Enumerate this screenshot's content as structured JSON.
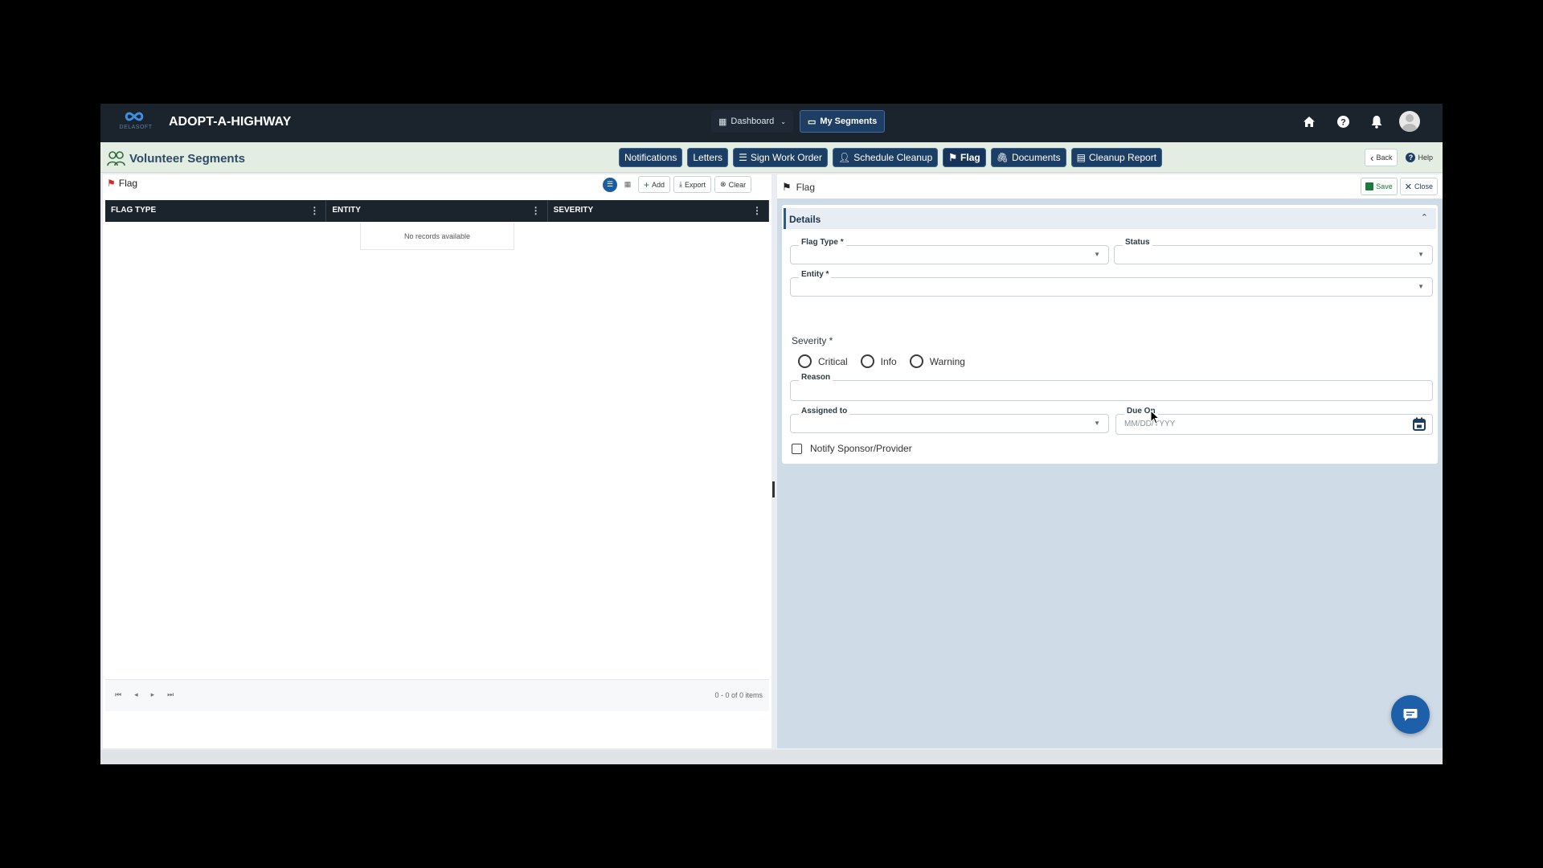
{
  "app": {
    "logo_text": "DELASOFT",
    "title": "ADOPT-A-HIGHWAY"
  },
  "topnav": {
    "dashboard": "Dashboard",
    "my_segments": "My Segments"
  },
  "page": {
    "title": "Volunteer Segments"
  },
  "actions": {
    "notifications": "Notifications",
    "letters": "Letters",
    "sign_work_order": "Sign Work Order",
    "schedule_cleanup": "Schedule Cleanup",
    "flag": "Flag",
    "documents": "Documents",
    "cleanup_report": "Cleanup Report"
  },
  "sub_right": {
    "back": "Back",
    "help": "Help"
  },
  "left_panel": {
    "title": "Flag",
    "add": "Add",
    "export": "Export",
    "clear": "Clear",
    "columns": [
      "FLAG TYPE",
      "ENTITY",
      "SEVERITY"
    ],
    "empty_text": "No records available",
    "pager_info": "0 - 0 of 0 items"
  },
  "right_panel": {
    "title": "Flag",
    "save": "Save",
    "close": "Close",
    "section": "Details",
    "fields": {
      "flag_type": "Flag Type *",
      "status": "Status",
      "entity": "Entity *",
      "severity": "Severity *",
      "reason": "Reason",
      "assigned_to": "Assigned to",
      "due_on": "Due On",
      "due_on_placeholder": "MM/DD/YYYY"
    },
    "severity_options": [
      "Critical",
      "Info",
      "Warning"
    ],
    "notify_label": "Notify Sponsor/Provider"
  },
  "colors": {
    "topbar": "#1b232d",
    "accent": "#1c3d64",
    "fab": "#1d5fa8"
  }
}
